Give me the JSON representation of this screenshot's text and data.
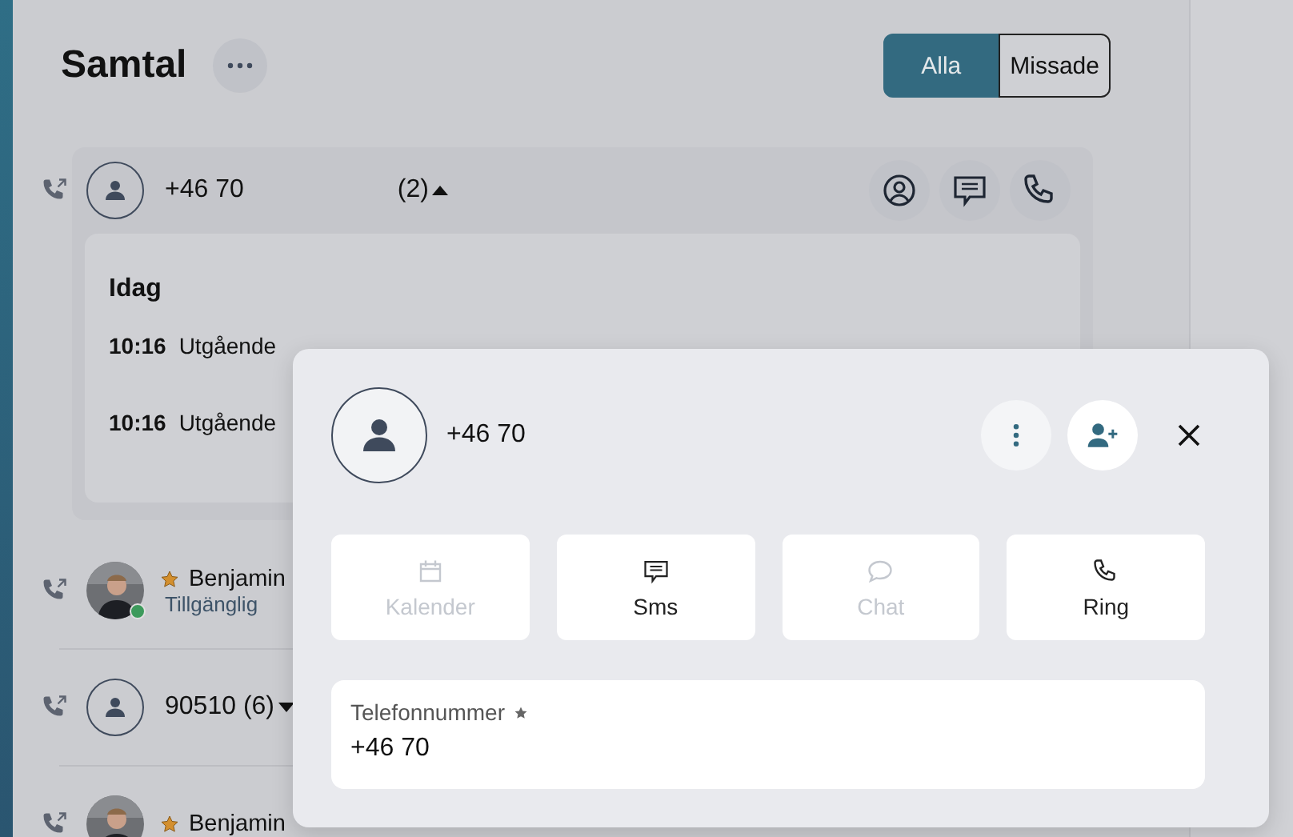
{
  "header": {
    "title": "Samtal",
    "filters": [
      {
        "label": "Alla",
        "selected": true
      },
      {
        "label": "Missade",
        "selected": false
      }
    ]
  },
  "calls": [
    {
      "kind": "number",
      "name": "+46 70",
      "count": "(2)",
      "expanded": true,
      "details": {
        "day": "Idag",
        "entries": [
          {
            "time": "10:16",
            "type": "Utgående"
          },
          {
            "time": "10:16",
            "type": "Utgående"
          }
        ]
      }
    },
    {
      "kind": "contact",
      "name": "Benjamin",
      "favorite": true,
      "status": "Tillgänglig",
      "color": "#3d9a5c"
    },
    {
      "kind": "number",
      "name": "90510 (6)",
      "expanded": false
    },
    {
      "kind": "contact",
      "name": "Benjamin",
      "favorite": true
    }
  ],
  "popup": {
    "number": "+46 70",
    "actions": [
      {
        "kind": "calendar",
        "label": "Kalender",
        "disabled": true
      },
      {
        "kind": "sms",
        "label": "Sms",
        "disabled": false
      },
      {
        "kind": "chat",
        "label": "Chat",
        "disabled": true
      },
      {
        "kind": "phone",
        "label": "Ring",
        "disabled": false
      }
    ],
    "field": {
      "label": "Telefonnummer",
      "required": true,
      "value": "+46 70"
    }
  }
}
